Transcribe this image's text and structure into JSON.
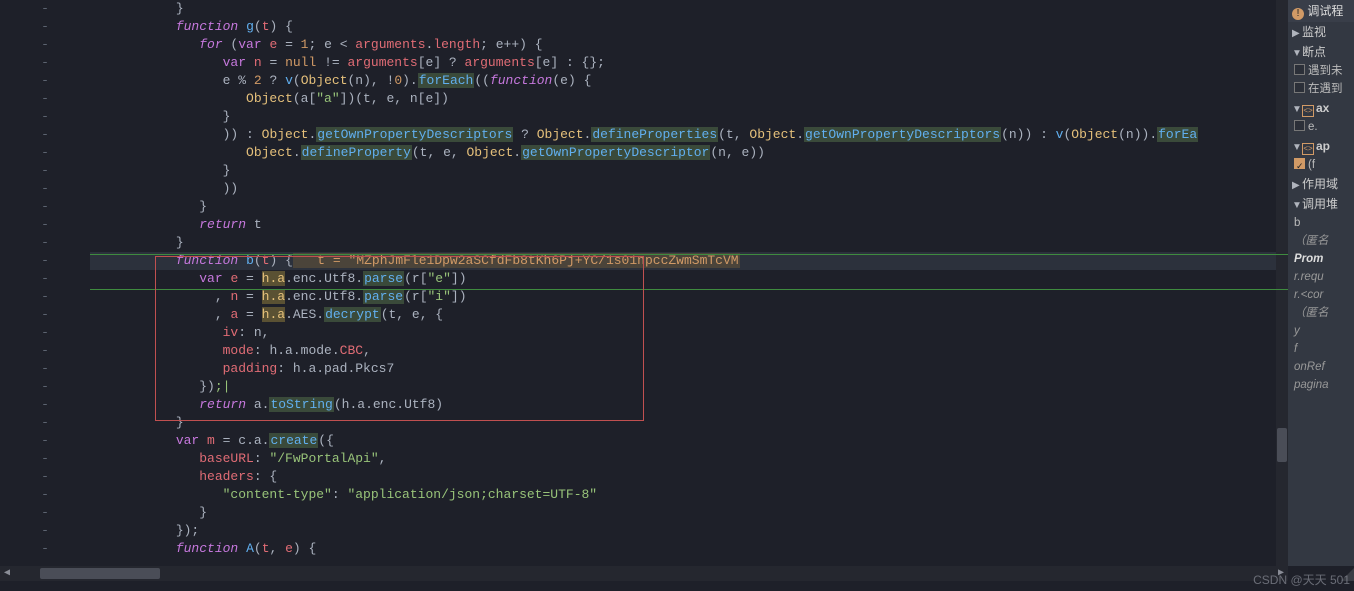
{
  "gutter_marker": "-",
  "code_lines": [
    {
      "ind": 11,
      "tokens": [
        [
          "punc",
          "}"
        ]
      ]
    },
    {
      "ind": 11,
      "tokens": [
        [
          "keyword",
          "function"
        ],
        [
          "punc",
          " "
        ],
        [
          "fnname",
          "g"
        ],
        [
          "punc",
          "("
        ],
        [
          "var",
          "t"
        ],
        [
          "punc",
          ") {"
        ]
      ]
    },
    {
      "ind": 14,
      "tokens": [
        [
          "keyword",
          "for"
        ],
        [
          "punc",
          " ("
        ],
        [
          "keyword-plain",
          "var"
        ],
        [
          "punc",
          " "
        ],
        [
          "var",
          "e"
        ],
        [
          "punc",
          " = "
        ],
        [
          "number",
          "1"
        ],
        [
          "punc",
          "; e < "
        ],
        [
          "var",
          "arguments"
        ],
        [
          "punc",
          "."
        ],
        [
          "prop",
          "length"
        ],
        [
          "punc",
          "; e++) {"
        ]
      ]
    },
    {
      "ind": 17,
      "tokens": [
        [
          "keyword-plain",
          "var"
        ],
        [
          "punc",
          " "
        ],
        [
          "var",
          "n"
        ],
        [
          "punc",
          " = "
        ],
        [
          "number",
          "null"
        ],
        [
          "punc",
          " != "
        ],
        [
          "var",
          "arguments"
        ],
        [
          "punc",
          "[e] ? "
        ],
        [
          "var",
          "arguments"
        ],
        [
          "punc",
          "[e] : {};"
        ]
      ]
    },
    {
      "ind": 17,
      "tokens": [
        [
          "punc",
          "e % "
        ],
        [
          "number",
          "2"
        ],
        [
          "punc",
          " ? "
        ],
        [
          "fnname",
          "v"
        ],
        [
          "punc",
          "("
        ],
        [
          "builtin",
          "Object"
        ],
        [
          "punc",
          "(n), !"
        ],
        [
          "number",
          "0"
        ],
        [
          "punc",
          ")."
        ],
        [
          "call",
          "forEach"
        ],
        [
          "punc",
          "(("
        ],
        [
          "keyword",
          "function"
        ],
        [
          "punc",
          "(e) {"
        ]
      ]
    },
    {
      "ind": 20,
      "tokens": [
        [
          "builtin",
          "Object"
        ],
        [
          "punc",
          "(a["
        ],
        [
          "string",
          "\"a\""
        ],
        [
          "punc",
          "])(t, e, n[e])"
        ]
      ]
    },
    {
      "ind": 17,
      "tokens": [
        [
          "punc",
          "}"
        ]
      ]
    },
    {
      "ind": 17,
      "tokens": [
        [
          "punc",
          ")) : "
        ],
        [
          "builtin",
          "Object"
        ],
        [
          "punc",
          "."
        ],
        [
          "call",
          "getOwnPropertyDescriptors"
        ],
        [
          "punc",
          " ? "
        ],
        [
          "builtin",
          "Object"
        ],
        [
          "punc",
          "."
        ],
        [
          "call",
          "defineProperties"
        ],
        [
          "punc",
          "(t, "
        ],
        [
          "builtin",
          "Object"
        ],
        [
          "punc",
          "."
        ],
        [
          "call",
          "getOwnPropertyDescriptors"
        ],
        [
          "punc",
          "(n)) : "
        ],
        [
          "fnname",
          "v"
        ],
        [
          "punc",
          "("
        ],
        [
          "builtin",
          "Object"
        ],
        [
          "punc",
          "(n))."
        ],
        [
          "call",
          "forEa"
        ]
      ]
    },
    {
      "ind": 20,
      "tokens": [
        [
          "builtin",
          "Object"
        ],
        [
          "punc",
          "."
        ],
        [
          "call",
          "defineProperty"
        ],
        [
          "punc",
          "(t, e, "
        ],
        [
          "builtin",
          "Object"
        ],
        [
          "punc",
          "."
        ],
        [
          "call",
          "getOwnPropertyDescriptor"
        ],
        [
          "punc",
          "(n, e))"
        ]
      ]
    },
    {
      "ind": 17,
      "tokens": [
        [
          "punc",
          "}"
        ]
      ]
    },
    {
      "ind": 17,
      "tokens": [
        [
          "punc",
          "))"
        ]
      ]
    },
    {
      "ind": 14,
      "tokens": [
        [
          "punc",
          "}"
        ]
      ]
    },
    {
      "ind": 14,
      "tokens": [
        [
          "keyword",
          "return"
        ],
        [
          "punc",
          " t"
        ]
      ]
    },
    {
      "ind": 11,
      "tokens": [
        [
          "punc",
          "}"
        ]
      ]
    },
    {
      "ind": 11,
      "hl": true,
      "ann": "   t = \"MZphJmFle1Dpw2aSCfdFb8tKh6Pj+YC/1s01npccZwmSmTcVM",
      "tokens": [
        [
          "keyword",
          "function"
        ],
        [
          "punc",
          " "
        ],
        [
          "fnname",
          "b"
        ],
        [
          "punc",
          "("
        ],
        [
          "var",
          "t"
        ],
        [
          "punc",
          ") {"
        ]
      ]
    },
    {
      "ind": 14,
      "tokens": [
        [
          "keyword-plain",
          "var"
        ],
        [
          "punc",
          " "
        ],
        [
          "var",
          "e"
        ],
        [
          "punc",
          " = "
        ],
        [
          "annhl",
          "h.a"
        ],
        [
          "punc",
          ".enc.Utf8."
        ],
        [
          "call",
          "parse"
        ],
        [
          "punc",
          "(r["
        ],
        [
          "string",
          "\"e\""
        ],
        [
          "punc",
          "])"
        ]
      ]
    },
    {
      "ind": 16,
      "tokens": [
        [
          "punc",
          ", "
        ],
        [
          "var",
          "n"
        ],
        [
          "punc",
          " = "
        ],
        [
          "annhl",
          "h.a"
        ],
        [
          "punc",
          ".enc.Utf8."
        ],
        [
          "call",
          "parse"
        ],
        [
          "punc",
          "(r["
        ],
        [
          "string",
          "\"i\""
        ],
        [
          "punc",
          "])"
        ]
      ]
    },
    {
      "ind": 16,
      "tokens": [
        [
          "punc",
          ", "
        ],
        [
          "var",
          "a"
        ],
        [
          "punc",
          " = "
        ],
        [
          "annhl",
          "h.a"
        ],
        [
          "punc",
          ".AES."
        ],
        [
          "call",
          "decrypt"
        ],
        [
          "punc",
          "(t, e, {"
        ]
      ]
    },
    {
      "ind": 17,
      "tokens": [
        [
          "prop",
          "iv"
        ],
        [
          "punc",
          ": n,"
        ]
      ]
    },
    {
      "ind": 17,
      "tokens": [
        [
          "prop",
          "mode"
        ],
        [
          "punc",
          ": h.a.mode."
        ],
        [
          "prop",
          "CBC"
        ],
        [
          "punc",
          ","
        ]
      ]
    },
    {
      "ind": 17,
      "tokens": [
        [
          "prop",
          "padding"
        ],
        [
          "punc",
          ": h.a.pad.Pkcs7"
        ]
      ]
    },
    {
      "ind": 14,
      "tokens": [
        [
          "punc",
          "})"
        ],
        [
          "punc-green",
          ";|"
        ]
      ]
    },
    {
      "ind": 14,
      "tokens": [
        [
          "keyword",
          "return"
        ],
        [
          "punc",
          " a."
        ],
        [
          "call",
          "toString"
        ],
        [
          "punc",
          "(h.a.enc.Utf8)"
        ]
      ]
    },
    {
      "ind": 11,
      "tokens": [
        [
          "punc",
          "}"
        ]
      ]
    },
    {
      "ind": 11,
      "tokens": [
        [
          "keyword-plain",
          "var"
        ],
        [
          "punc",
          " "
        ],
        [
          "var",
          "m"
        ],
        [
          "punc",
          " = c.a."
        ],
        [
          "call",
          "create"
        ],
        [
          "punc",
          "({"
        ]
      ]
    },
    {
      "ind": 14,
      "tokens": [
        [
          "prop",
          "baseURL"
        ],
        [
          "punc",
          ": "
        ],
        [
          "string",
          "\"/FwPortalApi\""
        ],
        [
          "punc",
          ","
        ]
      ]
    },
    {
      "ind": 14,
      "tokens": [
        [
          "prop",
          "headers"
        ],
        [
          "punc",
          ": {"
        ]
      ]
    },
    {
      "ind": 17,
      "tokens": [
        [
          "string",
          "\"content-type\""
        ],
        [
          "punc",
          ": "
        ],
        [
          "string",
          "\"application/json;charset=UTF-8\""
        ]
      ]
    },
    {
      "ind": 14,
      "tokens": [
        [
          "punc",
          "}"
        ]
      ]
    },
    {
      "ind": 11,
      "tokens": [
        [
          "punc",
          "});"
        ]
      ]
    },
    {
      "ind": 11,
      "tokens": [
        [
          "keyword",
          "function"
        ],
        [
          "punc",
          " "
        ],
        [
          "fnname",
          "A"
        ],
        [
          "punc",
          "("
        ],
        [
          "var",
          "t"
        ],
        [
          "punc",
          ", "
        ],
        [
          "var",
          "e"
        ],
        [
          "punc",
          ") {"
        ]
      ]
    }
  ],
  "sidebar": {
    "header": "调试程",
    "watch": "监视",
    "breakpoints": "断点",
    "bp1": "遇到未",
    "bp2": "在遇到",
    "file1": "ax",
    "sub1": "e.",
    "file2": "ap",
    "sub2": "(f",
    "scope": "作用域",
    "callstack": "调用堆",
    "calls": [
      "b",
      "（匿名",
      "Prom",
      "r.requ",
      "r.<cor",
      "（匿名",
      "y",
      "f",
      "onRef",
      "pagina"
    ]
  },
  "watermark": "CSDN @天天 501"
}
